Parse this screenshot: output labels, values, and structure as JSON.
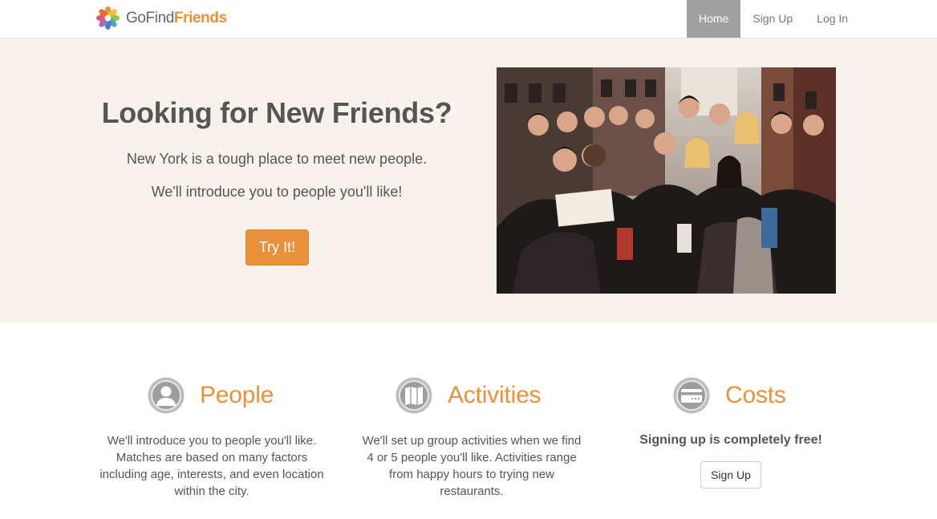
{
  "brand": {
    "name_part1": "GoFind",
    "name_part2": "Friends",
    "logo_icon": "flower-logo-icon"
  },
  "nav": {
    "items": [
      {
        "label": "Home",
        "active": true
      },
      {
        "label": "Sign Up",
        "active": false
      },
      {
        "label": "Log In",
        "active": false
      }
    ]
  },
  "hero": {
    "title": "Looking for New Friends?",
    "line1": "New York is a tough place to meet new people.",
    "line2": "We'll introduce you to people you'll like!",
    "button_label": "Try It!",
    "photo": "group-of-friends-photo"
  },
  "features": [
    {
      "icon": "person-icon",
      "title": "People",
      "body": "We'll introduce you to people you'll like. Matches are based on many factors including age, interests, and even location within the city."
    },
    {
      "icon": "map-icon",
      "title": "Activities",
      "body": "We'll set up group activities when we find 4 or 5 people you'll like. Activities range from happy hours to trying new restaurants."
    },
    {
      "icon": "credit-card-icon",
      "title": "Costs",
      "subtitle": "Signing up is completely free!",
      "button_label": "Sign Up"
    }
  ],
  "colors": {
    "accent": "#e8913a",
    "hero_bg": "#f7f3ec",
    "nav_active_bg": "#a0a0a0",
    "text": "#555555"
  }
}
